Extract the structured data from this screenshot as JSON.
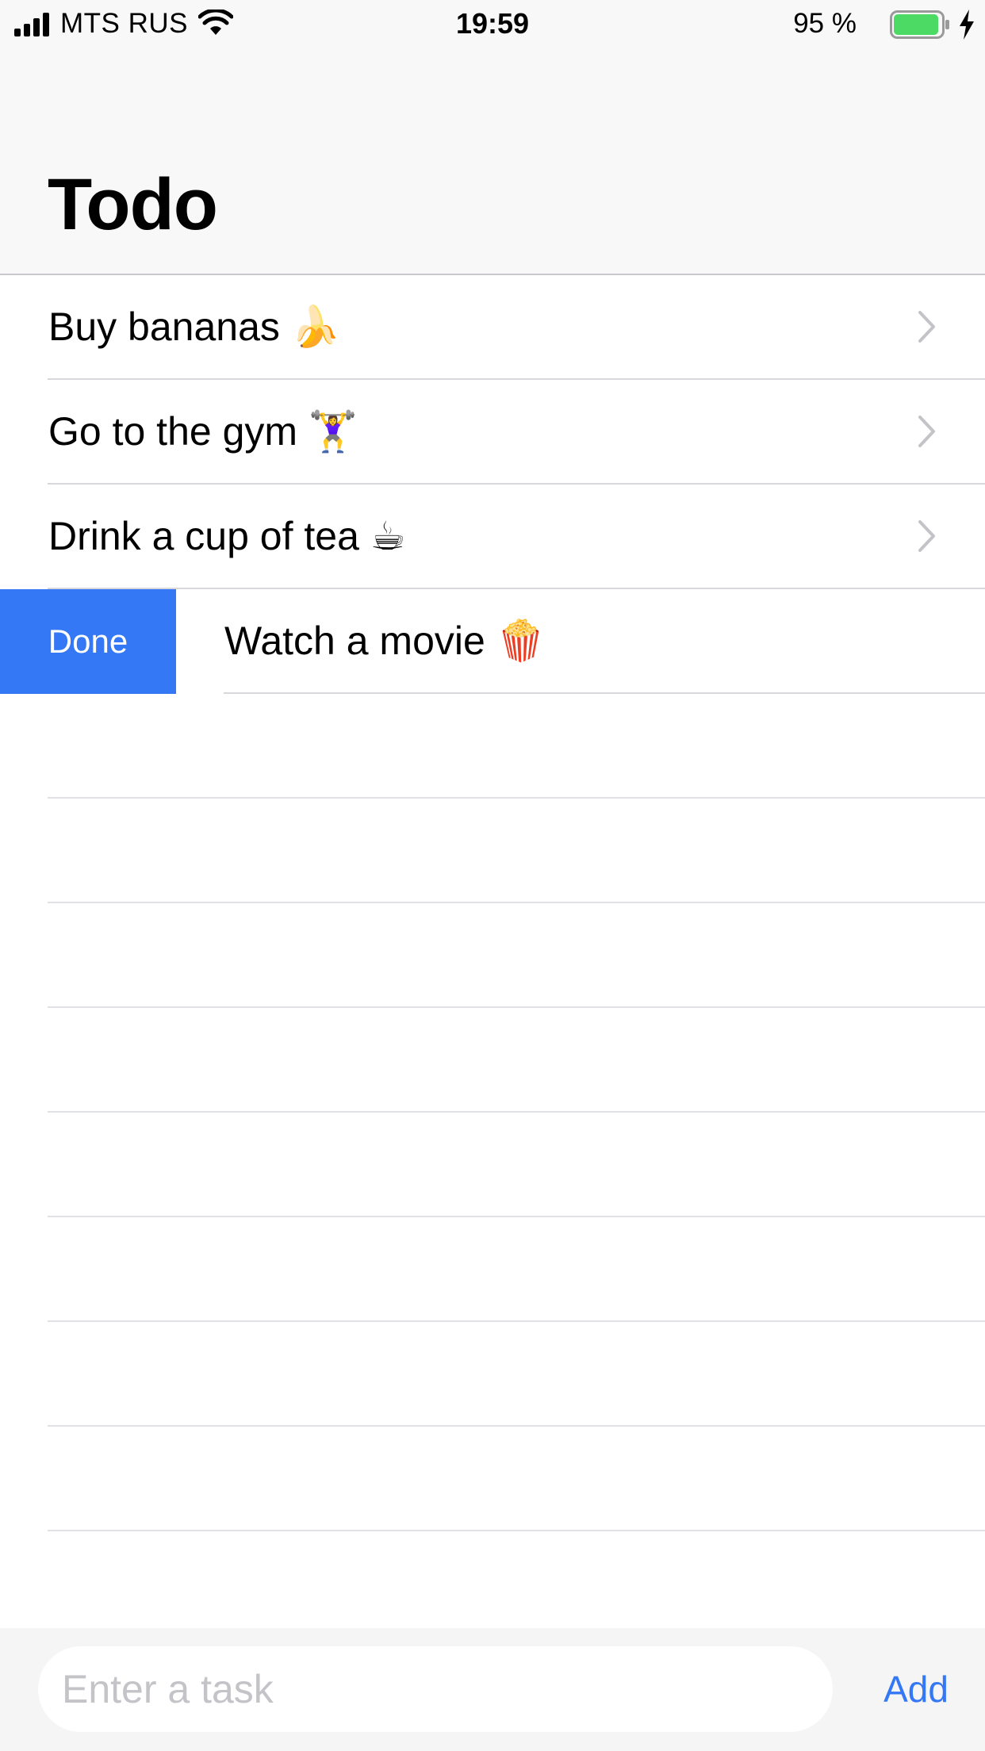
{
  "status_bar": {
    "carrier": "MTS RUS",
    "time": "19:59",
    "battery_percent": "95 %",
    "battery_level": 0.95,
    "signal_bars": 4,
    "icons": [
      "signal-icon",
      "wifi-icon",
      "battery-icon",
      "charging-bolt-icon"
    ]
  },
  "nav": {
    "title": "Todo"
  },
  "tasks": [
    {
      "label": "Buy bananas 🍌",
      "swiped": false
    },
    {
      "label": "Go to the gym 🏋️‍♀️",
      "swiped": false
    },
    {
      "label": "Drink a cup of tea ☕",
      "swiped": false
    },
    {
      "label": "Watch a movie 🍿",
      "swiped": true
    }
  ],
  "swipe_action": {
    "label": "Done",
    "color": "#3478f6"
  },
  "input_bar": {
    "placeholder": "Enter a task",
    "value": "",
    "add_label": "Add"
  },
  "colors": {
    "accent": "#3478f6",
    "battery_fill": "#4cd964"
  }
}
